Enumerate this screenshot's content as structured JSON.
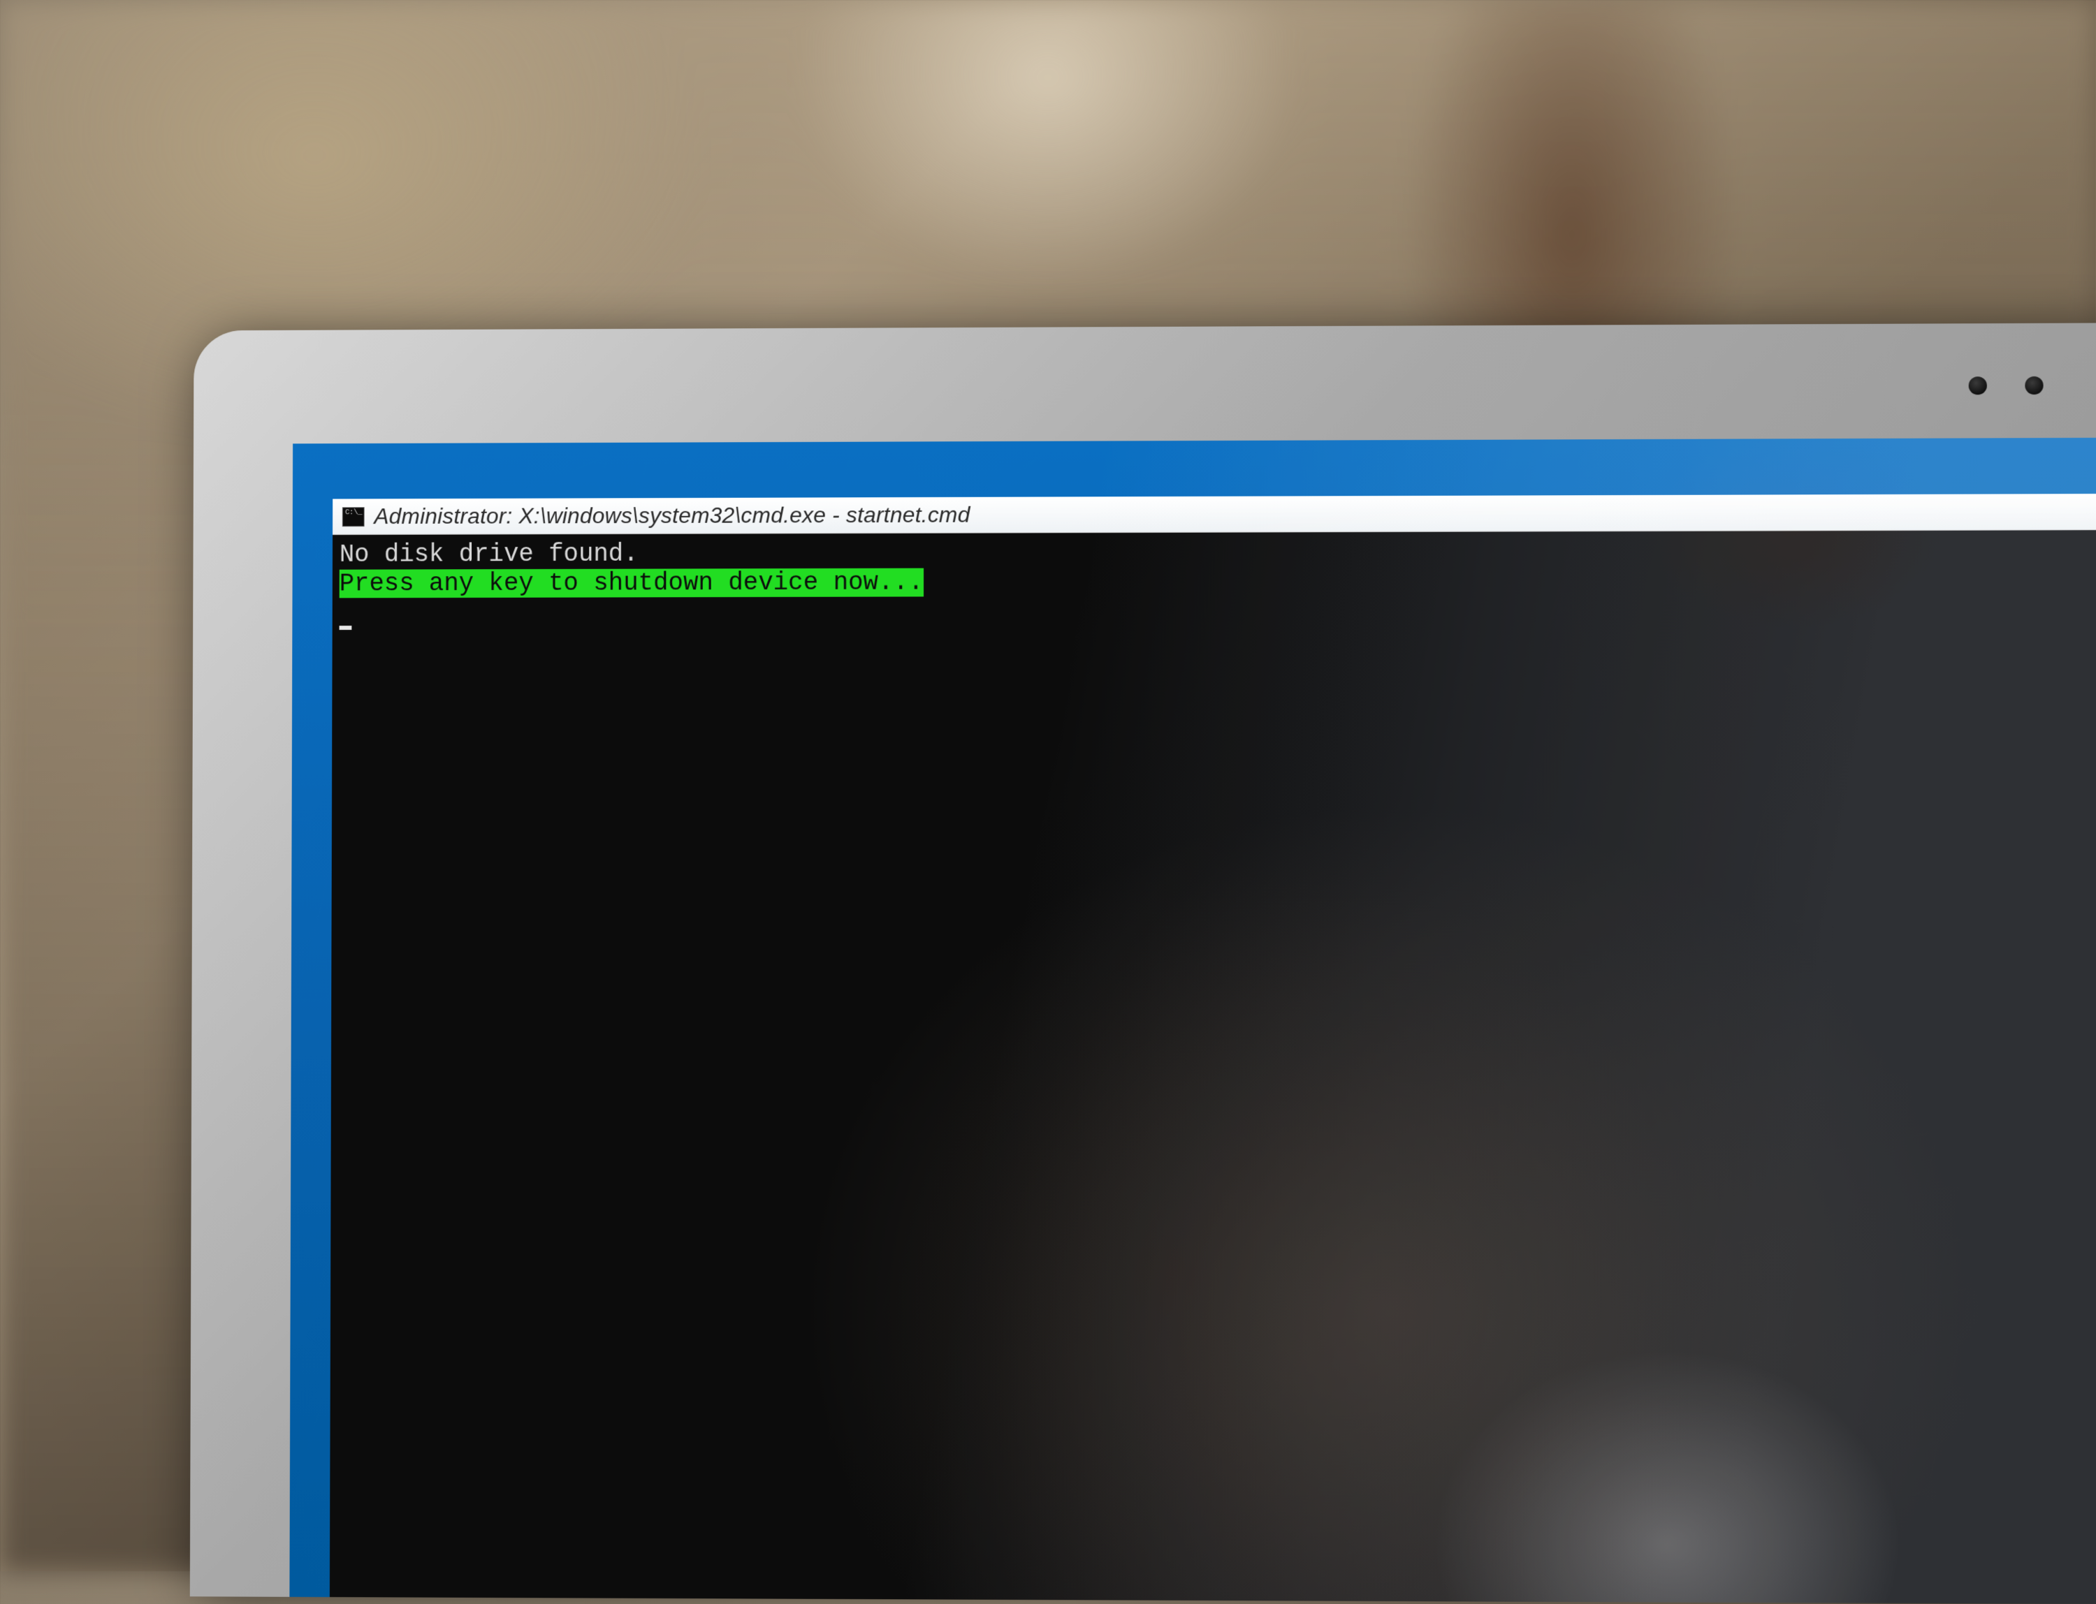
{
  "window": {
    "title": "Administrator: X:\\windows\\system32\\cmd.exe - startnet.cmd",
    "icon": "cmd-icon"
  },
  "terminal": {
    "line1": "No disk drive found.",
    "line2": "Press any key to shutdown device now..."
  },
  "colors": {
    "desktop": "#005a9e",
    "highlight_bg": "#22dd22",
    "terminal_bg": "#0c0c0c",
    "terminal_fg": "#e8e8e8"
  }
}
